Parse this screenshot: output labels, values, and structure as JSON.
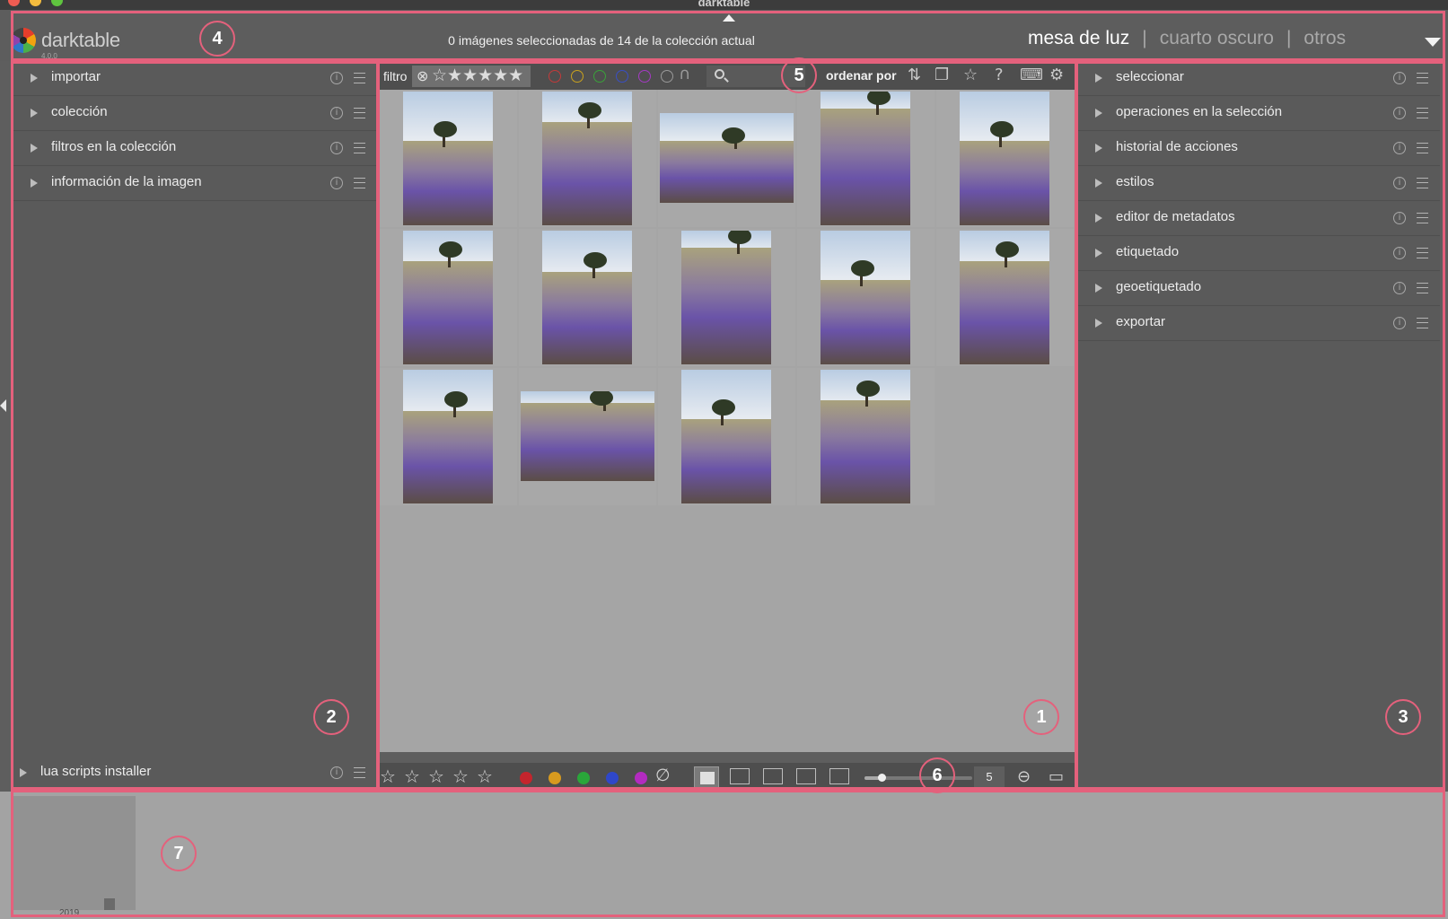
{
  "window": {
    "title": "darktable"
  },
  "header": {
    "logo_text": "darktable",
    "logo_version": "4.0.0",
    "status": "0 imágenes seleccionadas de 14 de la colección actual",
    "views": [
      {
        "label": "mesa de luz",
        "active": true
      },
      {
        "label": "cuarto oscuro",
        "active": false
      },
      {
        "label": "otros",
        "active": false
      }
    ],
    "separator": "|"
  },
  "left_panel": {
    "modules": [
      {
        "label": "importar"
      },
      {
        "label": "colección"
      },
      {
        "label": "filtros en la colección"
      },
      {
        "label": "información de la imagen"
      }
    ],
    "bottom_module": {
      "label": "lua scripts installer"
    },
    "info_glyph": "i"
  },
  "right_panel": {
    "modules": [
      {
        "label": "seleccionar"
      },
      {
        "label": "operaciones en la selección"
      },
      {
        "label": "historial de acciones"
      },
      {
        "label": "estilos"
      },
      {
        "label": "editor de metadatos"
      },
      {
        "label": "etiquetado"
      },
      {
        "label": "geoetiquetado"
      },
      {
        "label": "exportar"
      }
    ]
  },
  "top_toolbar": {
    "filter_label": "filtro",
    "reject_symbol": "⊗",
    "rating_stars": "☆★★★★★",
    "color_labels": [
      "#c33a3a",
      "#caa21e",
      "#3aa23a",
      "#3a4fc3",
      "#a43ac3",
      "#9a9a9a"
    ],
    "and_symbol": "∩",
    "sort_label": "ordenar por",
    "icons": [
      "sort-order-icon",
      "grouping-icon",
      "overlay-star-icon",
      "help-icon",
      "shortcuts-icon",
      "preferences-icon"
    ],
    "help_glyph": "?"
  },
  "lighttable": {
    "image_count": 14,
    "columns": 5
  },
  "bottom_toolbar": {
    "star_glyph": "☆",
    "stars": 5,
    "color_labels": [
      "#c4252d",
      "#d79a1f",
      "#2aa63a",
      "#2f47c9",
      "#b32bc0"
    ],
    "clear_symbol": "∅",
    "zoom_value": "5",
    "zoom_fraction": 0.16
  },
  "filmstrip": {
    "timeline_year": "2019"
  },
  "annotations": [
    "1",
    "2",
    "3",
    "4",
    "5",
    "6",
    "7"
  ]
}
